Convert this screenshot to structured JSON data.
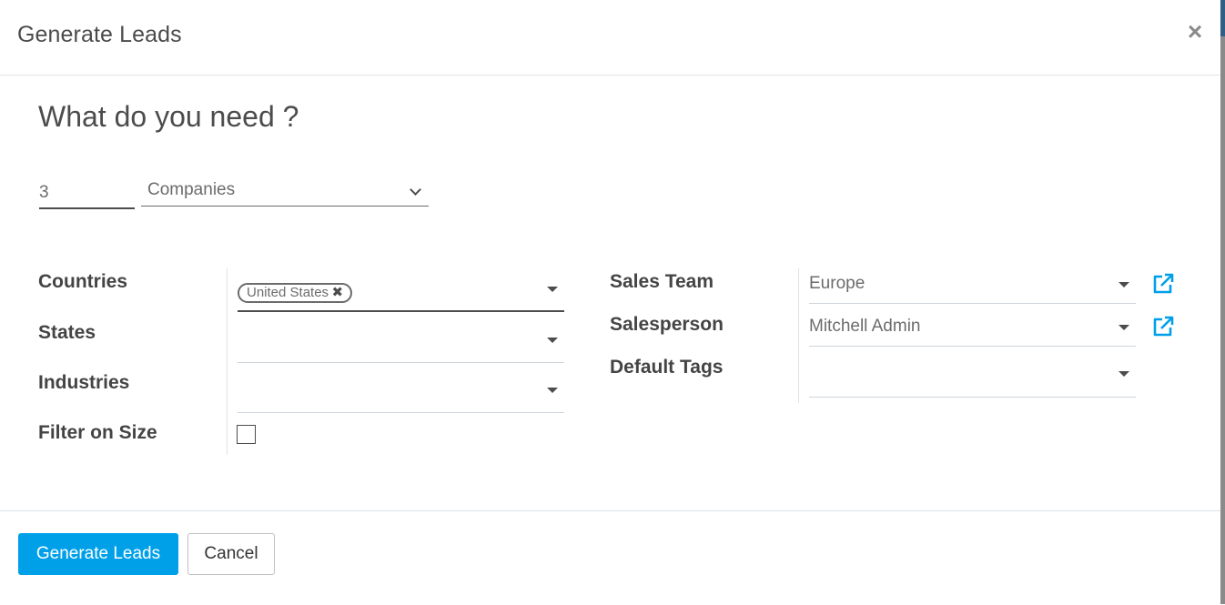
{
  "modal": {
    "title": "Generate Leads",
    "close_label": "×"
  },
  "form": {
    "heading": "What do you need ?",
    "count": "3",
    "lead_type": "Companies"
  },
  "left_fields": {
    "countries_label": "Countries",
    "countries_tags": [
      "United States"
    ],
    "states_label": "States",
    "states_value": "",
    "industries_label": "Industries",
    "industries_value": "",
    "filter_size_label": "Filter on Size",
    "filter_size_checked": false
  },
  "right_fields": {
    "sales_team_label": "Sales Team",
    "sales_team_value": "Europe",
    "salesperson_label": "Salesperson",
    "salesperson_value": "Mitchell Admin",
    "default_tags_label": "Default Tags",
    "default_tags_value": ""
  },
  "footer": {
    "generate_label": "Generate Leads",
    "cancel_label": "Cancel"
  },
  "icons": {
    "close": "close-icon",
    "dropdown": "caret-down-icon",
    "chevron": "chevron-down-icon",
    "external": "external-link-icon",
    "tag_remove": "remove-tag-icon"
  },
  "colors": {
    "primary": "#00a0e9",
    "link": "#00a0e9",
    "text": "#4c4c4c"
  }
}
